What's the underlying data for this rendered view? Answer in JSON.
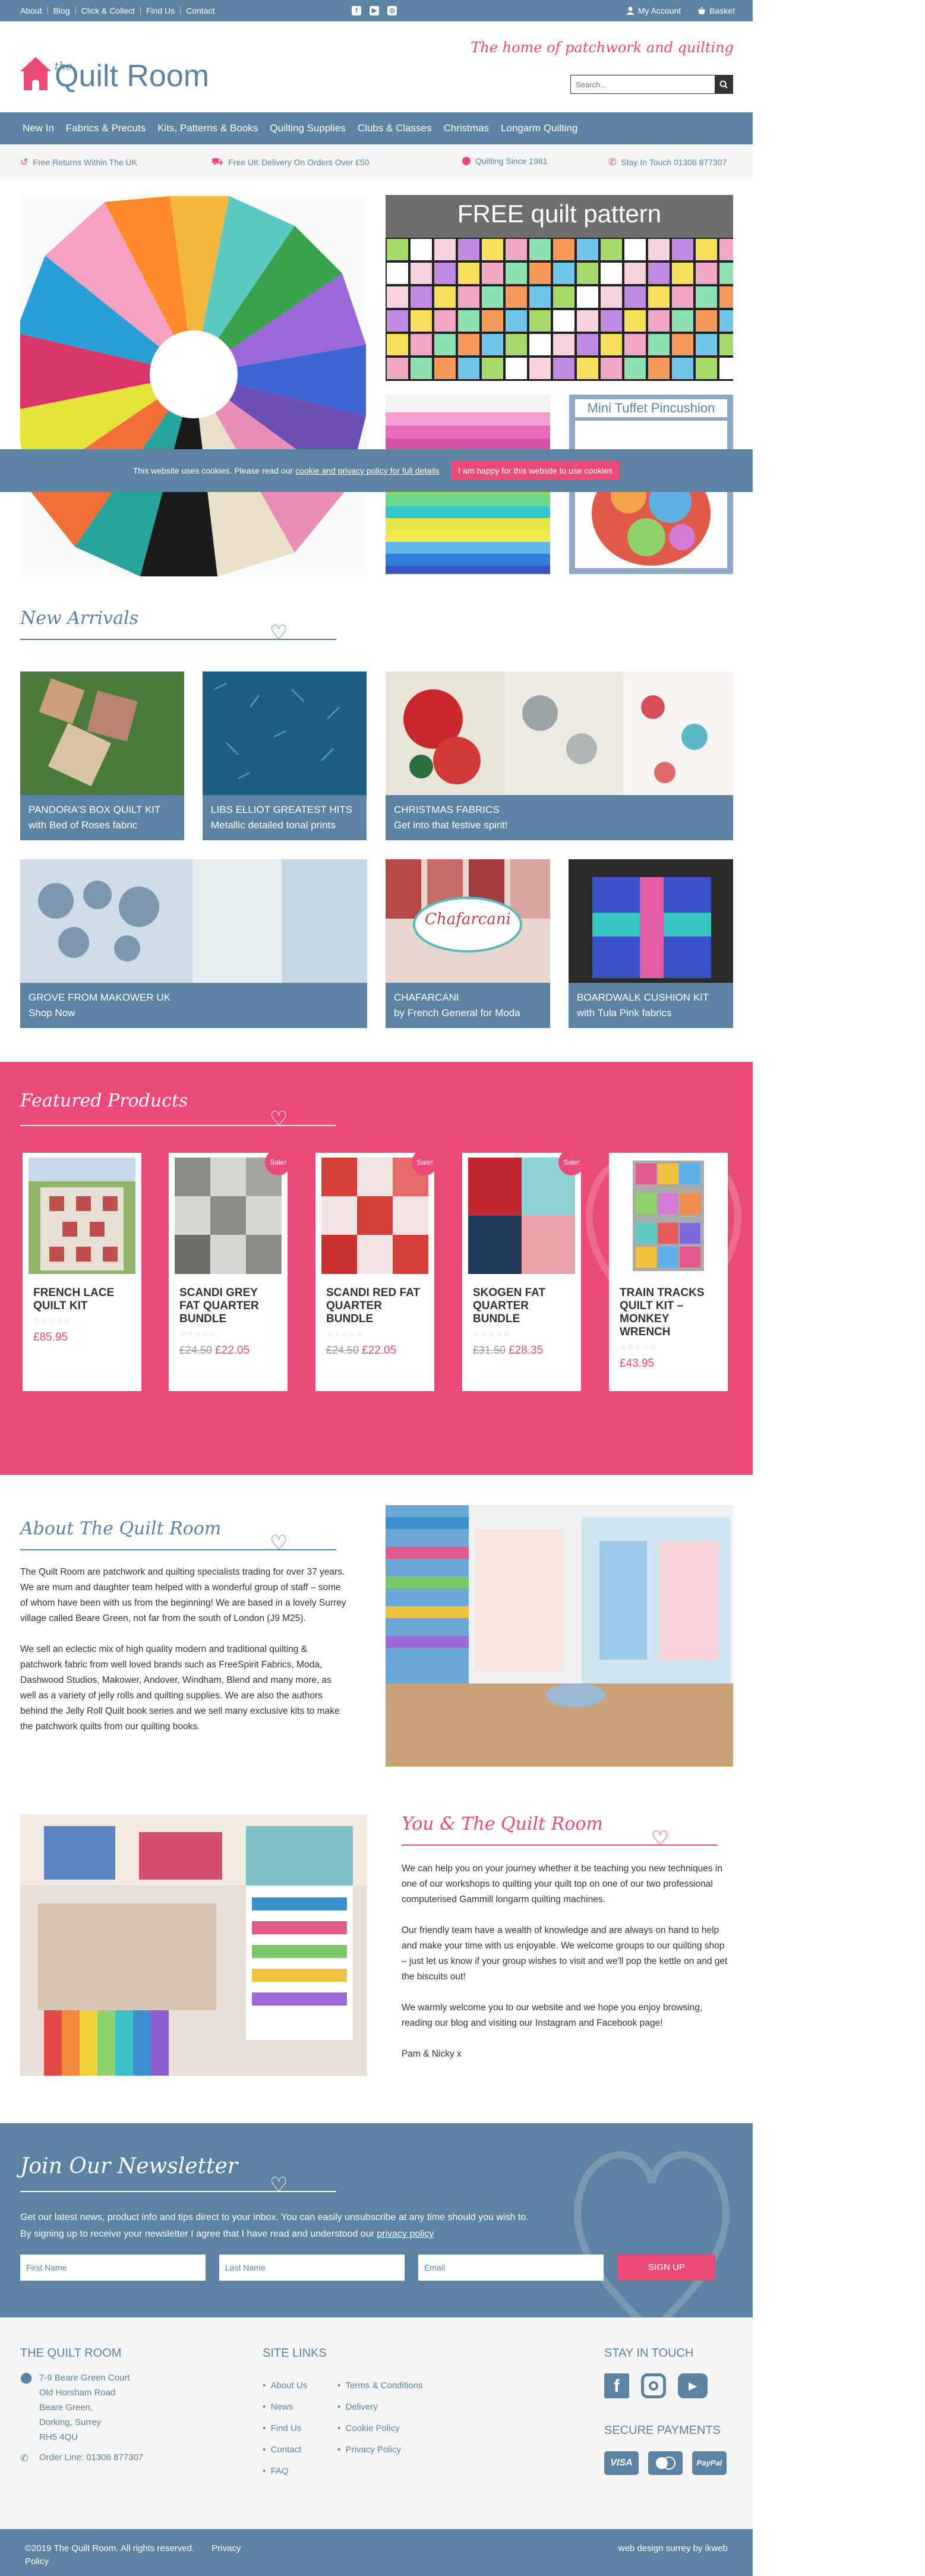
{
  "topbar": {
    "links": [
      "About",
      "Blog",
      "Click & Collect",
      "Find Us",
      "Contact"
    ],
    "social_icons": [
      "facebook-icon",
      "youtube-icon",
      "instagram-icon"
    ],
    "my_account": "My Account",
    "basket": "Basket"
  },
  "header": {
    "logo_small": "the",
    "logo_text": "Quilt Room",
    "tagline": "The home of patchwork and quilting",
    "search_placeholder": "Search..."
  },
  "nav": [
    "New In",
    "Fabrics & Precuts",
    "Kits, Patterns & Books",
    "Quilting Supplies",
    "Clubs & Classes",
    "Christmas",
    "Longarm Quilting"
  ],
  "benefits": [
    "Free Returns Within The UK",
    "Free UK Delivery On Orders Over £50",
    "Quilting Since 1981",
    "Stay In Touch 01306 877307"
  ],
  "hero": {
    "pattern_title": "FREE quilt pattern",
    "pincushion_title": "Mini Tuffet Pincushion"
  },
  "cookie": {
    "text": "This website uses cookies. Please read our",
    "link": "cookie and privacy policy for full details",
    "button": "I am happy for this website to use cookies"
  },
  "new_arrivals": {
    "title": "New Arrivals",
    "tiles": [
      {
        "line1": "PANDORA'S BOX QUILT KIT",
        "line2": "with Bed of Roses fabric"
      },
      {
        "line1": "LIBS ELLIOT GREATEST HITS",
        "line2": "Metallic detailed tonal prints"
      },
      {
        "line1": "CHRISTMAS FABRICS",
        "line2": "Get into that festive spirit!"
      },
      {
        "line1": "GROVE FROM MAKOWER UK",
        "line2": "Shop Now"
      },
      {
        "line1": "CHAFARCANI",
        "line2": "by French General for Moda"
      },
      {
        "line1": "BOARDWALK CUSHION KIT",
        "line2": "with Tula Pink fabrics"
      }
    ],
    "chafarcani_label": "Chafarcani"
  },
  "featured": {
    "title": "Featured Products",
    "products": [
      {
        "name": "FRENCH LACE QUILT KIT",
        "old_price": "",
        "price": "£85.95",
        "sale": ""
      },
      {
        "name": "SCANDI GREY FAT QUARTER BUNDLE",
        "old_price": "£24.50",
        "price": "£22.05",
        "sale": "Sale!"
      },
      {
        "name": "SCANDI RED FAT QUARTER BUNDLE",
        "old_price": "£24.50",
        "price": "£22.05",
        "sale": "Sale!"
      },
      {
        "name": "SKOGEN FAT QUARTER BUNDLE",
        "old_price": "£31.50",
        "price": "£28.35",
        "sale": "Sale!"
      },
      {
        "name": "TRAIN TRACKS QUILT KIT – MONKEY WRENCH",
        "old_price": "",
        "price": "£43.95",
        "sale": ""
      }
    ],
    "stars": "☆☆☆☆☆"
  },
  "about": {
    "title": "About The Quilt Room",
    "p1": "The Quilt Room are patchwork and quilting specialists trading for over 37 years. We are mum and daughter team helped with a wonderful group of staff – some of whom have been with us from the beginning! We are based in a lovely Surrey village called Beare Green, not far from the south of London (J9 M25).",
    "p2": "We sell an eclectic mix of high quality modern and traditional quilting & patchwork fabric from well loved brands such as FreeSpirit Fabrics, Moda, Dashwood Studios, Makower, Andover, Windham, Blend and many more, as well as a variety of jelly rolls and quilting supplies. We are also the authors behind the Jelly Roll Quilt book series and we sell many exclusive kits to make the patchwork quilts from our quilting books."
  },
  "you": {
    "title": "You & The Quilt Room",
    "p1": "We can help you on your journey whether it be teaching you new techniques in one of our workshops to quilting your quilt top on one of our two professional computerised Gammill longarm quilting machines.",
    "p2": "Our friendly team have a wealth of knowledge and are always on hand to help and make your time with us enjoyable. We welcome groups to our quilting shop – just let us know if your group wishes to visit and we'll pop the kettle on and get the biscuits out!",
    "p3": "We warmly welcome you to our website and we hope you enjoy browsing, reading our blog and visiting our Instagram and Facebook page!",
    "p4": "Pam & Nicky x"
  },
  "newsletter": {
    "title": "Join Our Newsletter",
    "line1": "Get our latest news, product info and tips direct to your inbox. You can easily unsubscribe at any time should you wish to.",
    "line2": "By signing up to receive your newsletter I agree that I have read and understood our",
    "line2_link": "privacy policy",
    "first_name": "First Name",
    "last_name": "Last Name",
    "email": "Email",
    "signup": "SIGN UP"
  },
  "footer": {
    "col1_title": "THE QUILT ROOM",
    "address": [
      "7-9 Beare Green Court",
      "Old Horsham Road",
      "Beare Green,",
      "Dorking, Surrey",
      "RH5 4QU"
    ],
    "order_line": "Order Line: 01306 877307",
    "col2_title": "SITE LINKS",
    "links_a": [
      "About Us",
      "News",
      "Find Us",
      "Contact",
      "FAQ"
    ],
    "links_b": [
      "Terms & Conditions",
      "Delivery",
      "Cookie Policy",
      "Privacy Policy"
    ],
    "col3_title": "STAY IN TOUCH",
    "payments_title": "SECURE PAYMENTS",
    "payments": [
      "VISA",
      "MC",
      "PayPal"
    ]
  },
  "bottom": {
    "copyright": "©2019 The Quilt Room. All rights reserved.",
    "privacy": "Privacy Policy",
    "credit": "web design surrey by ikweb"
  },
  "colors": {
    "blue": "#5d83a2",
    "pink": "#e94a77",
    "light": "#f5f5f5"
  }
}
